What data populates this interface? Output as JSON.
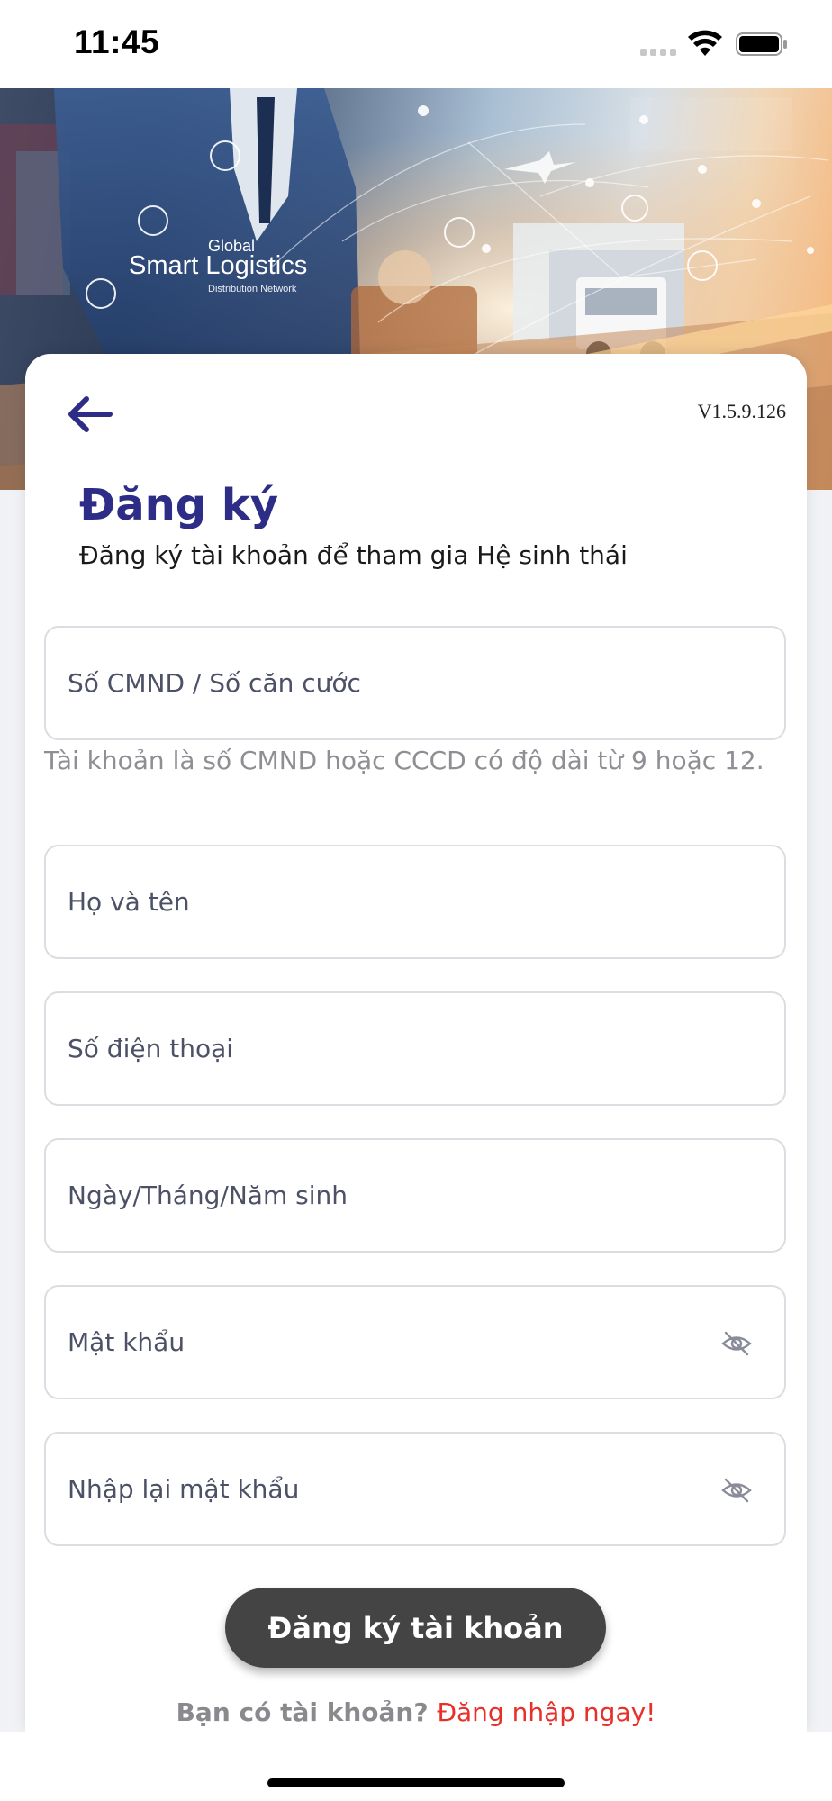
{
  "status_bar": {
    "time": "11:45"
  },
  "hero": {
    "logo_global": "Global",
    "logo_title": "Smart Logistics",
    "logo_subtitle": "Distribution Network"
  },
  "header": {
    "version": "V1.5.9.126",
    "title": "Đăng ký",
    "subtitle": "Đăng ký tài khoản để tham gia Hệ sinh thái"
  },
  "form": {
    "id_number": {
      "placeholder": "Số CMND / Số căn cước",
      "value": ""
    },
    "id_hint": "Tài khoản là số CMND hoặc CCCD có độ dài từ 9 hoặc 12.",
    "full_name": {
      "placeholder": "Họ và tên",
      "value": ""
    },
    "phone": {
      "placeholder": "Số điện thoại",
      "value": ""
    },
    "birthdate": {
      "placeholder": "Ngày/Tháng/Năm sinh",
      "value": ""
    },
    "password": {
      "placeholder": "Mật khẩu",
      "value": ""
    },
    "confirm_password": {
      "placeholder": "Nhập lại mật khẩu",
      "value": ""
    }
  },
  "actions": {
    "register_label": "Đăng ký tài khoản",
    "login_prompt": "Bạn có tài khoản?",
    "login_link": "Đăng nhập ngay!"
  },
  "icons": {
    "back": "arrow-left-icon",
    "password_visibility": "eye-off-icon"
  },
  "colors": {
    "accent": "#2d2c86",
    "button": "#444444",
    "link": "#e8302a"
  }
}
